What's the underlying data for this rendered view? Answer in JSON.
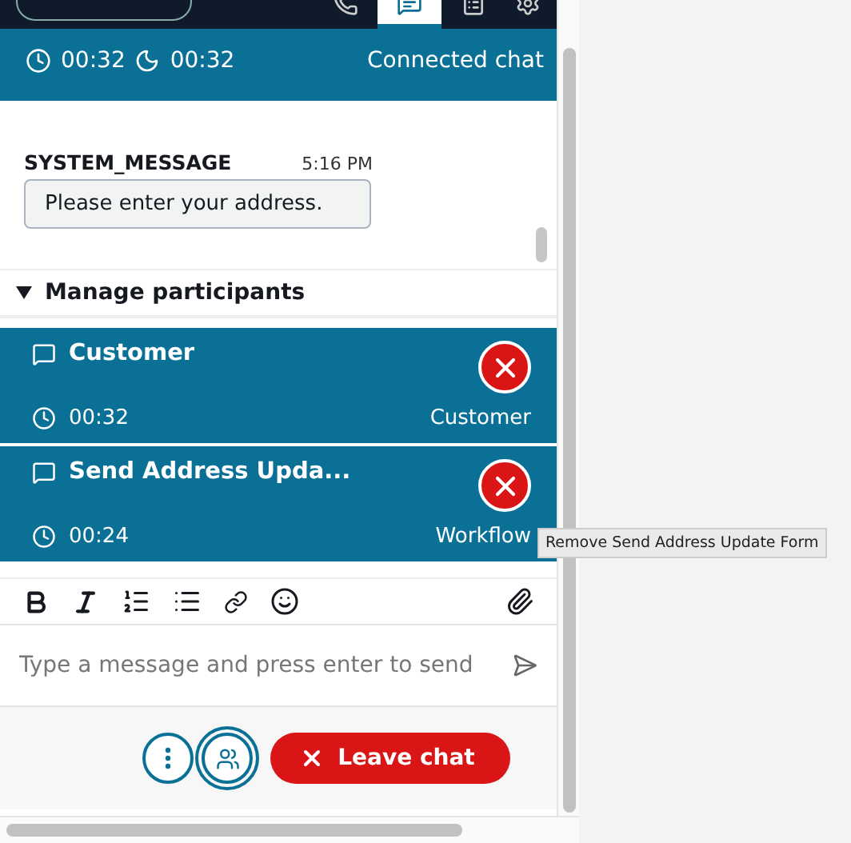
{
  "top_bar": {
    "tabs": [
      {
        "kind": "phone",
        "selected": false
      },
      {
        "kind": "chat",
        "selected": true
      },
      {
        "kind": "task",
        "selected": false
      },
      {
        "kind": "settings",
        "selected": false
      }
    ]
  },
  "contact": {
    "elapsed": "00:32",
    "after_contact": "00:32",
    "status": "Connected chat"
  },
  "messages": [
    {
      "sender": "SYSTEM_MESSAGE",
      "time": "5:16 PM",
      "text": "Please enter your address."
    }
  ],
  "participants": {
    "title": "Manage participants",
    "expanded": true,
    "items": [
      {
        "name": "Customer",
        "time": "00:32",
        "role": "Customer"
      },
      {
        "name": "Send Address Upda...",
        "time": "00:24",
        "role": "Workflow"
      }
    ]
  },
  "tooltip": "Remove Send Address Update Form",
  "composer": {
    "placeholder": "Type a message and press enter to send"
  },
  "actions": {
    "leave": "Leave chat",
    "participants_selected": true
  }
}
